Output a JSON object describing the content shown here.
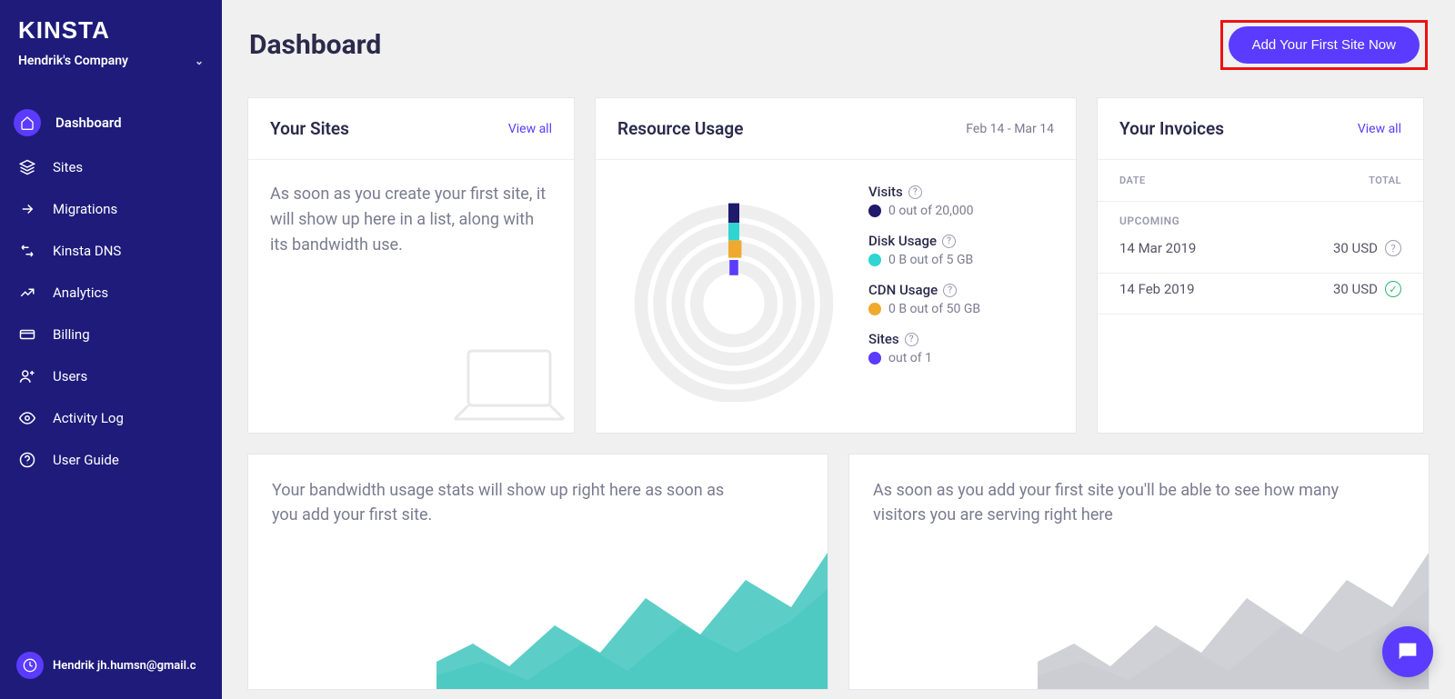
{
  "brand": "KINSTA",
  "company": "Hendrik's Company",
  "nav": {
    "dashboard": "Dashboard",
    "sites": "Sites",
    "migrations": "Migrations",
    "dns": "Kinsta DNS",
    "analytics": "Analytics",
    "billing": "Billing",
    "users": "Users",
    "activity": "Activity Log",
    "guide": "User Guide"
  },
  "user": {
    "email": "Hendrik jh.humsn@gmail.c"
  },
  "header": {
    "title": "Dashboard",
    "add_button": "Add Your First Site Now"
  },
  "sites": {
    "title": "Your Sites",
    "view_all": "View all",
    "empty": "As soon as you create your first site, it will show up here in a list, along with its bandwidth use."
  },
  "resource": {
    "title": "Resource Usage",
    "range": "Feb 14 - Mar 14",
    "visits": {
      "label": "Visits",
      "value": "0 out of 20,000",
      "color": "#1f1a6a"
    },
    "disk": {
      "label": "Disk Usage",
      "value": "0 B out of 5 GB",
      "color": "#2fd5d1"
    },
    "cdn": {
      "label": "CDN Usage",
      "value": "0 B out of 50 GB",
      "color": "#efa92e"
    },
    "sitesm": {
      "label": "Sites",
      "value": " out of 1",
      "color": "#5b3bff"
    }
  },
  "invoices": {
    "title": "Your Invoices",
    "view_all": "View all",
    "col_date": "DATE",
    "col_total": "TOTAL",
    "upcoming": "UPCOMING",
    "rows": [
      {
        "date": "14 Mar 2019",
        "total": "30 USD",
        "status": "pending"
      },
      {
        "date": "14 Feb 2019",
        "total": "30 USD",
        "status": "paid"
      }
    ]
  },
  "bandwidth_card": "Your bandwidth usage stats will show up right here as soon as you add your first site.",
  "visitors_card": "As soon as you add your first site you'll be able to see how many visitors you are serving right here",
  "colors": {
    "accent": "#5b3bff",
    "sidebar": "#1e1b7b",
    "teal": "#3fc6bd",
    "grey": "#c7c9d0"
  }
}
